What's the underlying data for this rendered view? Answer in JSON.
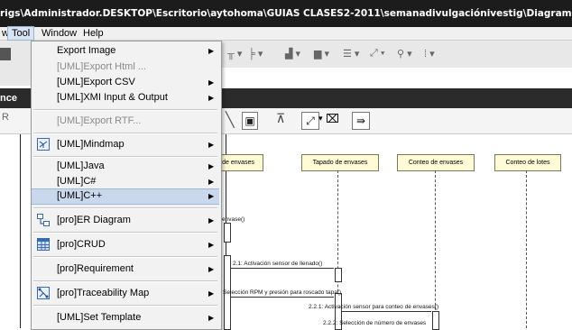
{
  "window": {
    "title": "rigs\\Administrador.DESKTOP\\Escritorio\\aytohoma\\GUIAS CLASES2-2011\\semanadivulgaciónivestig\\Diagramasecuenciaembotellado"
  },
  "menubar": {
    "items": [
      "w",
      "Tool",
      "Window",
      "Help"
    ]
  },
  "panel": {
    "label": "nce"
  },
  "menu": {
    "items": [
      {
        "label": "Export Image",
        "disabled": false,
        "submenu": true,
        "icon": ""
      },
      {
        "label": "[UML]Export Html ...",
        "disabled": true,
        "submenu": false,
        "icon": ""
      },
      {
        "label": "[UML]Export CSV",
        "disabled": false,
        "submenu": true,
        "icon": ""
      },
      {
        "label": "[UML]XMI Input & Output",
        "disabled": false,
        "submenu": true,
        "icon": ""
      },
      {
        "label": "[UML]Export RTF...",
        "disabled": true,
        "submenu": false,
        "icon": ""
      },
      {
        "label": "[UML]Mindmap",
        "disabled": false,
        "submenu": true,
        "icon": "mindmap-icon"
      },
      {
        "label": "[UML]Java",
        "disabled": false,
        "submenu": true,
        "icon": ""
      },
      {
        "label": "[UML]C#",
        "disabled": false,
        "submenu": true,
        "icon": ""
      },
      {
        "label": "[UML]C++",
        "disabled": false,
        "submenu": true,
        "icon": "",
        "highlighted": true
      },
      {
        "label": "[pro]ER Diagram",
        "disabled": false,
        "submenu": true,
        "icon": "er-diagram-icon"
      },
      {
        "label": "[pro]CRUD",
        "disabled": false,
        "submenu": true,
        "icon": "crud-table-icon"
      },
      {
        "label": "[pro]Requirement",
        "disabled": false,
        "submenu": true,
        "icon": ""
      },
      {
        "label": "[pro]Traceability Map",
        "disabled": false,
        "submenu": true,
        "icon": "traceability-map-icon"
      },
      {
        "label": "[UML]Set Template",
        "disabled": false,
        "submenu": true,
        "icon": ""
      }
    ]
  },
  "diagram": {
    "lifelines": [
      {
        "label": "de envases"
      },
      {
        "label": "Tapado de envases"
      },
      {
        "label": "Conteo de envases"
      },
      {
        "label": "Conteo de lotes"
      }
    ],
    "messages": [
      "envase()",
      "2.1: Activación sensor de llenado()",
      "2.: Selección RPM y presión para roscado tapa()",
      "2.2.1: Activación sensor para conteo de envases()",
      "2.2.2: Selección de número de envases"
    ]
  },
  "colors": {
    "titlebar": "#1c1c1c",
    "menu_highlight": "#c9d8ec",
    "lifeline_fill": "#fffbd6"
  }
}
